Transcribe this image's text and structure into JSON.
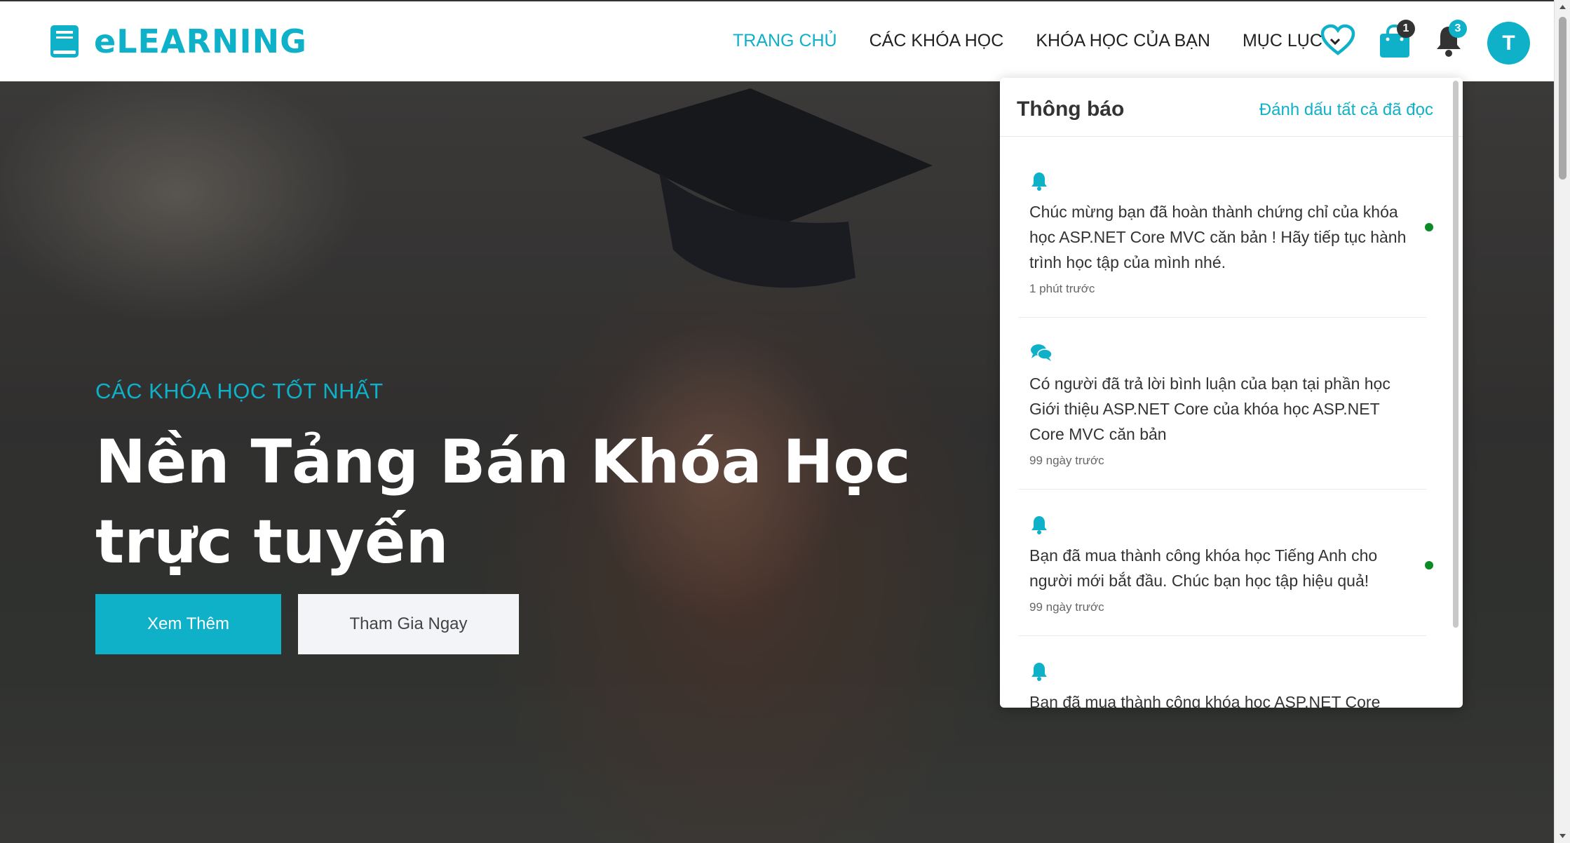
{
  "brand": {
    "name": "eLEARNING",
    "icon": "book-icon",
    "color": "#0fb1c8"
  },
  "nav": {
    "items": [
      {
        "label": "TRANG CHỦ",
        "active": true
      },
      {
        "label": "CÁC KHÓA HỌC",
        "active": false
      },
      {
        "label": "KHÓA HỌC CỦA BẠN",
        "active": false
      },
      {
        "label": "MỤC LỤC",
        "active": false
      }
    ]
  },
  "header_icons": {
    "wishlist": "heart-icon",
    "cart": {
      "icon": "shopping-bag-icon",
      "count": "1"
    },
    "notifications": {
      "icon": "bell-icon",
      "count": "3"
    },
    "avatar": {
      "initial": "T"
    }
  },
  "hero": {
    "subtitle": "CÁC KHÓA HỌC TỐT NHẤT",
    "title_line1": "Nền Tảng Bán Khóa Học",
    "title_line2": "trực tuyến",
    "primary_button": "Xem Thêm",
    "secondary_button": "Tham Gia Ngay"
  },
  "notifications": {
    "title": "Thông báo",
    "mark_all": "Đánh dấu tất cả đã đọc",
    "items": [
      {
        "icon": "bell-icon",
        "text": "Chúc mừng bạn đã hoàn thành chứng chỉ của khóa học ASP.NET Core MVC căn bản ! Hãy tiếp tục hành trình học tập của mình nhé.",
        "time": "1 phút trước",
        "unread": true
      },
      {
        "icon": "comments-icon",
        "text": "Có người đã trả lời bình luận của bạn tại phần học Giới thiệu ASP.NET Core của khóa học ASP.NET Core MVC căn bản",
        "time": "99 ngày trước",
        "unread": false
      },
      {
        "icon": "bell-icon",
        "text": "Bạn đã mua thành công khóa học Tiếng Anh cho người mới bắt đầu. Chúc bạn học tập hiệu quả!",
        "time": "99 ngày trước",
        "unread": true
      },
      {
        "icon": "bell-icon",
        "text": "Bạn đã mua thành công khóa học ASP.NET Core",
        "time": "",
        "unread": true
      }
    ]
  },
  "colors": {
    "accent": "#0fb1c8",
    "unread_dot": "#0b8a26",
    "cart_badge": "#333333",
    "bell_badge": "#0fb1c8"
  }
}
